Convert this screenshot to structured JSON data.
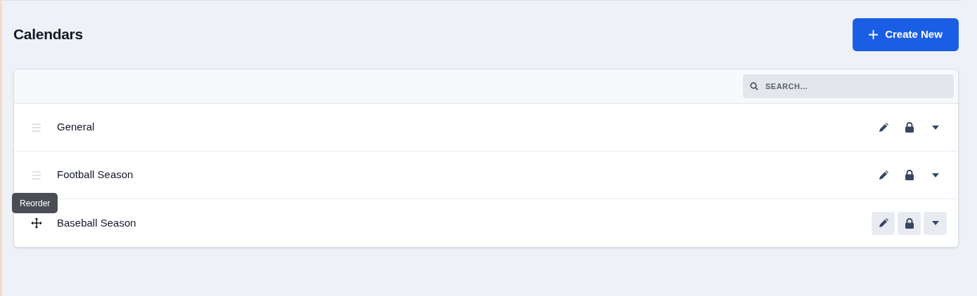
{
  "page": {
    "title": "Calendars"
  },
  "create_button": {
    "label": "Create New"
  },
  "search": {
    "placeholder": "SEARCH..."
  },
  "calendars": [
    {
      "name": "General",
      "hovered": false
    },
    {
      "name": "Football Season",
      "hovered": false
    },
    {
      "name": "Baseball Season",
      "hovered": true,
      "tooltip": "Reorder"
    }
  ]
}
